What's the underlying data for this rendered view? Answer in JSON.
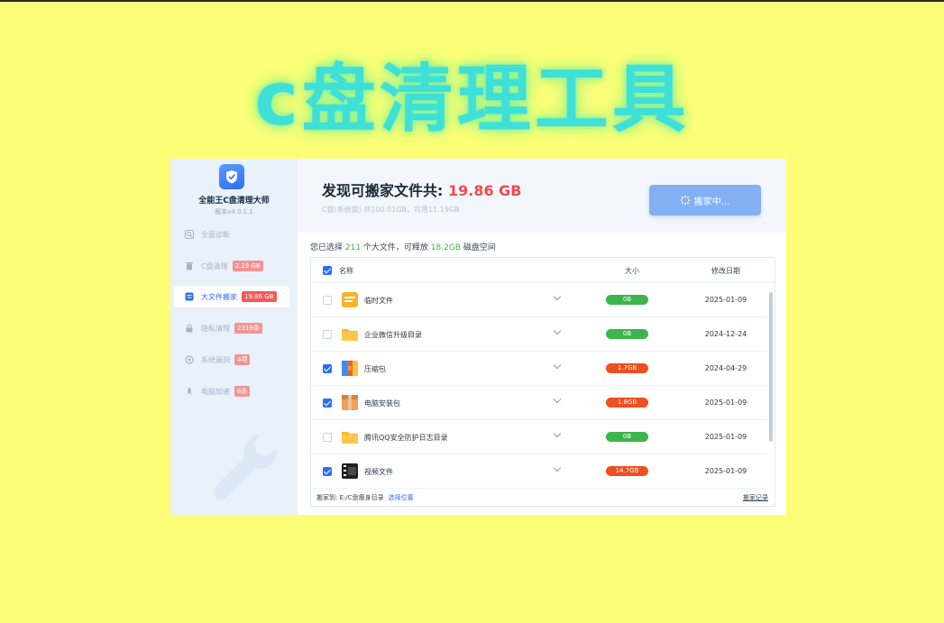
{
  "banner": {
    "title": "c盘清理工具"
  },
  "app": {
    "name": "全能王C盘清理大师",
    "version": "版本v4.0.1.1"
  },
  "sidebar": {
    "items": [
      {
        "label": "全面诊断",
        "badge": "",
        "icon": "scan-icon",
        "active": false
      },
      {
        "label": "C盘清理",
        "badge": "2.19 GB",
        "icon": "trash-icon",
        "active": false
      },
      {
        "label": "大文件搬家",
        "badge": "19.86 GB",
        "icon": "file-move-icon",
        "active": true
      },
      {
        "label": "隐私清理",
        "badge": "2319条",
        "icon": "lock-icon",
        "active": false
      },
      {
        "label": "系统漏洞",
        "badge": "4项",
        "icon": "shield-scan-icon",
        "active": false
      },
      {
        "label": "电脑加速",
        "badge": "8条",
        "icon": "rocket-icon",
        "active": false
      }
    ]
  },
  "header": {
    "found_label": "发现可搬家文件共: ",
    "found_size": "19.86 GB",
    "disk_info": "C盘(系统盘) 共100.01GB，可用11.19GB",
    "move_button": "搬家中..."
  },
  "selection": {
    "prefix": "您已选择 ",
    "count": "211",
    "middle": " 个大文件，可释放 ",
    "size": "18.2GB",
    "suffix": " 磁盘空间"
  },
  "table": {
    "columns": {
      "name": "名称",
      "size": "大小",
      "date": "修改日期"
    },
    "rows": [
      {
        "name": "临时文件",
        "size": "0B",
        "date": "2025-01-09",
        "checked": false,
        "icon": "temp-file-icon",
        "size_color": "#3cb54a"
      },
      {
        "name": "企业微信升级目录",
        "size": "0B",
        "date": "2024-12-24",
        "checked": false,
        "icon": "folder-icon",
        "size_color": "#3cb54a"
      },
      {
        "name": "压缩包",
        "size": "1.7GB",
        "date": "2024-04-29",
        "checked": true,
        "icon": "archive-icon",
        "size_color": "#ef4f1e"
      },
      {
        "name": "电脑安装包",
        "size": "1.8GB",
        "date": "2025-01-09",
        "checked": true,
        "icon": "package-icon",
        "size_color": "#ef4f1e"
      },
      {
        "name": "腾讯QQ安全防护日志目录",
        "size": "0B",
        "date": "2025-01-09",
        "checked": false,
        "icon": "folder-icon",
        "size_color": "#3cb54a"
      },
      {
        "name": "视频文件",
        "size": "14.7GB",
        "date": "2025-01-09",
        "checked": true,
        "icon": "video-file-icon",
        "size_color": "#ef4f1e"
      }
    ]
  },
  "footer": {
    "dest_label": "搬家到: E:/C盘瘦身目录",
    "choose_label": "选择位置",
    "history_label": "搬家记录"
  }
}
